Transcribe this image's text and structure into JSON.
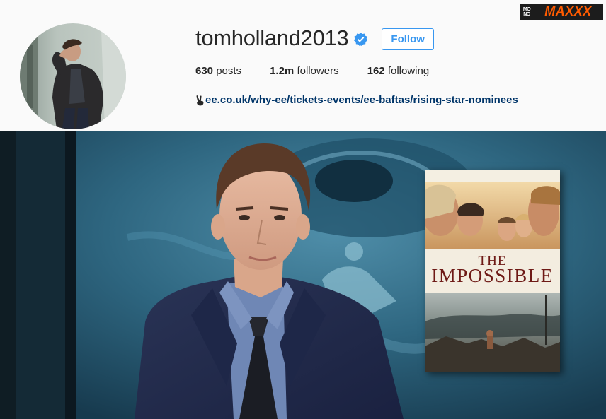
{
  "profile": {
    "username": "tomholland2013",
    "verified": true,
    "follow_label": "Follow",
    "website": "ee.co.uk/why-ee/tickets-events/ee-baftas/rising-star-nominees",
    "website_prefix_icon": "victory-hand-icon",
    "stats": {
      "posts_count": "630",
      "posts_label": "posts",
      "followers_count": "1.2m",
      "followers_label": "followers",
      "following_count": "162",
      "following_label": "following"
    }
  },
  "watermark": {
    "mono_top": "MO",
    "mono_bottom": "NO",
    "brand": "MAXXX"
  },
  "poster": {
    "title_line1": "THE",
    "title_line2": "IMPOSSIBLE"
  },
  "colors": {
    "accent_blue": "#3897f0",
    "link_blue": "#003569",
    "verified_blue": "#3897f0",
    "watermark_orange": "#ff5b00",
    "poster_title_red": "#6e1a16"
  }
}
